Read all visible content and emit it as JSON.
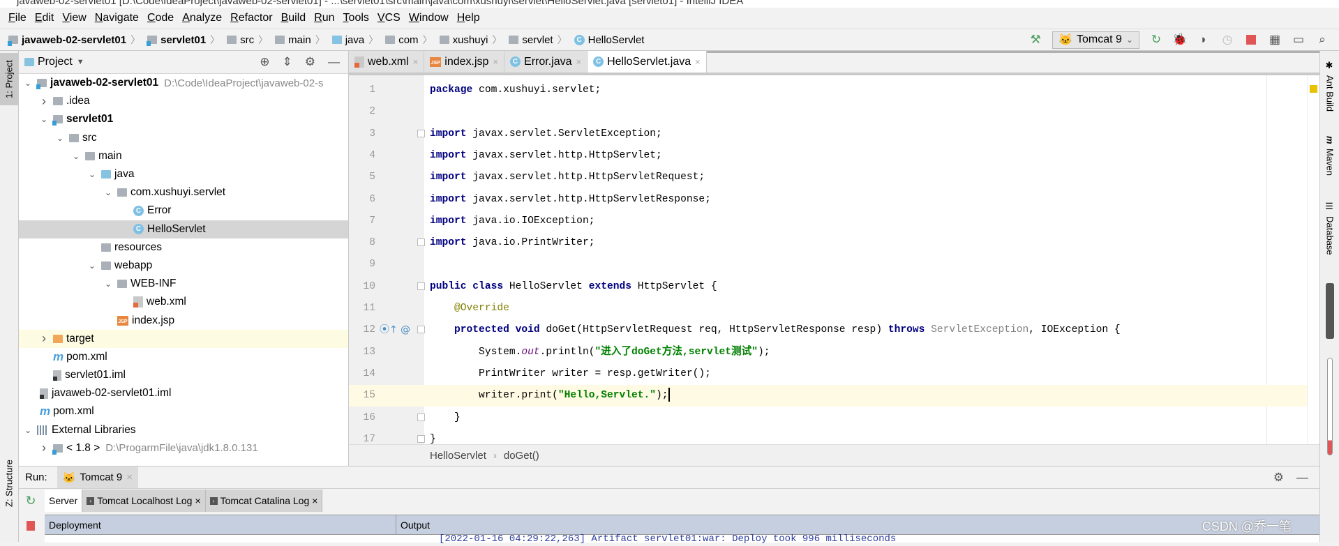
{
  "window": {
    "title": "javaweb-02-servlet01 [D:\\Code\\IdeaProject\\javaweb-02-servlet01] - ...\\servlet01\\src\\main\\java\\com\\xushuyi\\servlet\\HelloServlet.java [servlet01] - IntelliJ IDEA"
  },
  "menu": [
    "File",
    "Edit",
    "View",
    "Navigate",
    "Code",
    "Analyze",
    "Refactor",
    "Build",
    "Run",
    "Tools",
    "VCS",
    "Window",
    "Help"
  ],
  "navbar": {
    "crumbs": [
      {
        "label": "javaweb-02-servlet01",
        "icon": "module-folder-icon",
        "bold": true
      },
      {
        "label": "servlet01",
        "icon": "module-folder-icon",
        "bold": true
      },
      {
        "label": "src",
        "icon": "folder-icon"
      },
      {
        "label": "main",
        "icon": "folder-icon"
      },
      {
        "label": "java",
        "icon": "source-folder-icon"
      },
      {
        "label": "com",
        "icon": "package-icon"
      },
      {
        "label": "xushuyi",
        "icon": "package-icon"
      },
      {
        "label": "servlet",
        "icon": "package-icon"
      },
      {
        "label": "HelloServlet",
        "icon": "class-icon"
      }
    ]
  },
  "toolbar": {
    "run_config": "Tomcat 9",
    "icons": [
      "build-hammer-icon",
      "rerun-icon",
      "debug-icon",
      "coverage-icon",
      "profile-icon",
      "stop-icon",
      "project-structure-icon",
      "terminal-icon",
      "search-icon"
    ],
    "accent": "#4a9e5c",
    "stop_color": "#e05555"
  },
  "left_stripe": {
    "project": "1: Project",
    "structure": "Z: Structure"
  },
  "right_stripe": [
    "Ant Build",
    "Maven",
    "Database"
  ],
  "project": {
    "title": "Project",
    "tree": [
      {
        "label": "javaweb-02-servlet01",
        "path": "D:\\Code\\IdeaProject\\javaweb-02-s",
        "level": 0,
        "arrow": "open",
        "icon": "module",
        "bold": true
      },
      {
        "label": ".idea",
        "level": 1,
        "arrow": "closed",
        "icon": "folder"
      },
      {
        "label": "servlet01",
        "level": 1,
        "arrow": "open",
        "icon": "module",
        "bold": true
      },
      {
        "label": "src",
        "level": 2,
        "arrow": "open",
        "icon": "folder"
      },
      {
        "label": "main",
        "level": 3,
        "arrow": "open",
        "icon": "folder"
      },
      {
        "label": "java",
        "level": 4,
        "arrow": "open",
        "icon": "src"
      },
      {
        "label": "com.xushuyi.servlet",
        "level": 5,
        "arrow": "open",
        "icon": "folder"
      },
      {
        "label": "Error",
        "level": 6,
        "arrow": "none",
        "icon": "class"
      },
      {
        "label": "HelloServlet",
        "level": 6,
        "arrow": "none",
        "icon": "class",
        "selected": true
      },
      {
        "label": "resources",
        "level": 4,
        "arrow": "none",
        "icon": "folder"
      },
      {
        "label": "webapp",
        "level": 4,
        "arrow": "open",
        "icon": "folder"
      },
      {
        "label": "WEB-INF",
        "level": 5,
        "arrow": "open",
        "icon": "folder"
      },
      {
        "label": "web.xml",
        "level": 6,
        "arrow": "none",
        "icon": "xml"
      },
      {
        "label": "index.jsp",
        "level": 5,
        "arrow": "none",
        "icon": "jsp"
      },
      {
        "label": "target",
        "level": 1,
        "arrow": "closed",
        "icon": "orange",
        "excluded": true
      },
      {
        "label": "pom.xml",
        "level": 1,
        "arrow": "none",
        "icon": "maven"
      },
      {
        "label": "servlet01.iml",
        "level": 1,
        "arrow": "none",
        "icon": "iml"
      },
      {
        "label": "javaweb-02-servlet01.iml",
        "level": 0,
        "arrow": "none",
        "icon": "iml",
        "leaf": true
      },
      {
        "label": "pom.xml",
        "level": 0,
        "arrow": "none",
        "icon": "maven",
        "leaf": true
      },
      {
        "label": "External Libraries",
        "level": 0,
        "arrow": "open",
        "icon": "lib"
      },
      {
        "label": "< 1.8 >",
        "path": "D:\\ProgarmFile\\java\\jdk1.8.0.131",
        "level": 1,
        "arrow": "closed",
        "icon": "module"
      }
    ]
  },
  "tabs": [
    {
      "label": "web.xml",
      "icon": "xml"
    },
    {
      "label": "index.jsp",
      "icon": "jsp"
    },
    {
      "label": "Error.java",
      "icon": "class"
    },
    {
      "label": "HelloServlet.java",
      "icon": "class",
      "active": true
    }
  ],
  "code": {
    "current_line": 15,
    "lines": [
      [
        {
          "t": "package",
          "c": "kw"
        },
        {
          "t": " com.xushuyi.servlet;"
        }
      ],
      [],
      [
        {
          "t": "import",
          "c": "kw"
        },
        {
          "t": " javax.servlet.ServletException;"
        }
      ],
      [
        {
          "t": "import",
          "c": "kw"
        },
        {
          "t": " javax.servlet.http.HttpServlet;"
        }
      ],
      [
        {
          "t": "import",
          "c": "kw"
        },
        {
          "t": " javax.servlet.http.HttpServletRequest;"
        }
      ],
      [
        {
          "t": "import",
          "c": "kw"
        },
        {
          "t": " javax.servlet.http.HttpServletResponse;"
        }
      ],
      [
        {
          "t": "import",
          "c": "kw"
        },
        {
          "t": " java.io.IOException;"
        }
      ],
      [
        {
          "t": "import",
          "c": "kw"
        },
        {
          "t": " java.io.PrintWriter;"
        }
      ],
      [],
      [
        {
          "t": "public class",
          "c": "kw"
        },
        {
          "t": " HelloServlet "
        },
        {
          "t": "extends",
          "c": "kw"
        },
        {
          "t": " HttpServlet {"
        }
      ],
      [
        {
          "t": "    "
        },
        {
          "t": "@Override",
          "c": "ann"
        }
      ],
      [
        {
          "t": "    "
        },
        {
          "t": "protected void",
          "c": "kw"
        },
        {
          "t": " doGet(HttpServletRequest req, HttpServletResponse resp) "
        },
        {
          "t": "throws",
          "c": "kw"
        },
        {
          "t": " "
        },
        {
          "t": "ServletException",
          "c": "gray"
        },
        {
          "t": ", IOException {"
        }
      ],
      [
        {
          "t": "        System."
        },
        {
          "t": "out",
          "c": "fld"
        },
        {
          "t": ".println("
        },
        {
          "t": "\"进入了doGet方法,servlet测试\"",
          "c": "str"
        },
        {
          "t": ");"
        }
      ],
      [
        {
          "t": "        PrintWriter writer = resp.getWriter();"
        }
      ],
      [
        {
          "t": "        writer.print("
        },
        {
          "t": "\"Hello,Servlet.\"",
          "c": "str"
        },
        {
          "t": ");"
        }
      ],
      [
        {
          "t": "    }"
        }
      ],
      [
        {
          "t": "}"
        }
      ]
    ],
    "fold_lines": [
      3,
      8,
      10,
      12,
      16,
      17
    ]
  },
  "editor_breadcrumb": [
    "HelloServlet",
    "doGet()"
  ],
  "run": {
    "label": "Run:",
    "tab": "Tomcat 9",
    "subtabs": [
      "Server",
      "Tomcat Localhost Log",
      "Tomcat Catalina Log"
    ],
    "columns": [
      "Deployment",
      "Output"
    ],
    "output_line": "[2022-01-16 04:29:22,263] Artifact servlet01:war: Deploy took 996 milliseconds"
  },
  "watermark": "CSDN @乔一笔"
}
